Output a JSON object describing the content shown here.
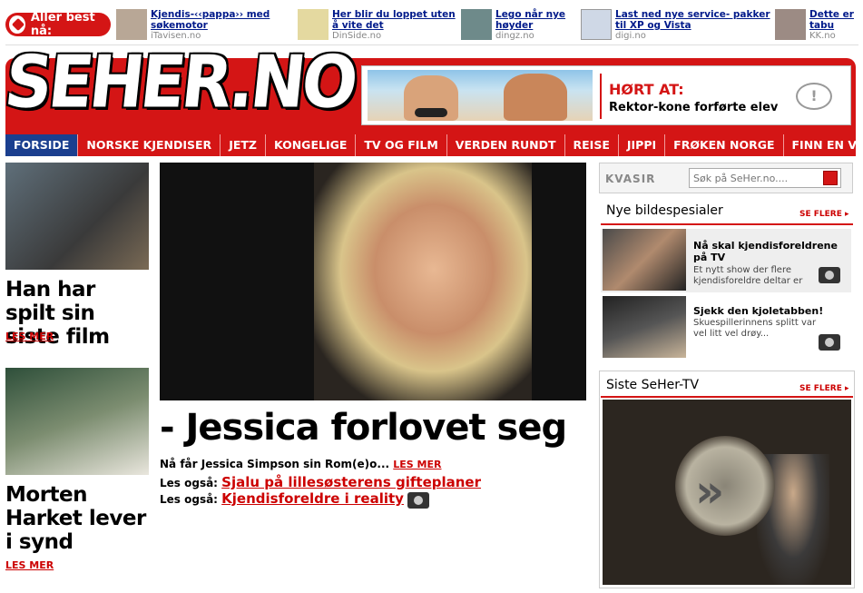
{
  "topbar": {
    "badge": "Aller best nå:",
    "promos": [
      {
        "title": "Kjendis-‹‹pappa›› med søkemotor",
        "source": "iTavisen.no"
      },
      {
        "title": "Her blir du loppet uten å vite det",
        "source": "DinSide.no"
      },
      {
        "title": "Lego når nye høyder",
        "source": "dingz.no"
      },
      {
        "title": "Last ned nye service- pakker til XP og Vista",
        "source": "digi.no"
      },
      {
        "title": "Dette er tabu",
        "source": "KK.no"
      }
    ]
  },
  "header": {
    "logo": "SEHER.NO",
    "banner_head": "HØRT AT:",
    "banner_sub": "Rektor-kone forførte elev"
  },
  "nav": [
    "FORSIDE",
    "NORSKE KJENDISER",
    "JETZ",
    "KONGELIGE",
    "TV OG FILM",
    "VERDEN RUNDT",
    "REISE",
    "JIPPI",
    "FRØKEN NORGE",
    "FINN EN VENN"
  ],
  "left": [
    {
      "headline": "Han har spilt sin siste film",
      "more": "LES MER"
    },
    {
      "headline": "Morten Harket lever i synd",
      "more": "LES MER"
    }
  ],
  "main": {
    "headline": "- Jessica forlovet seg",
    "lead": "Nå får Jessica Simpson sin Rom(e)o...",
    "lead_more": "LES MER",
    "also_label": "Les også:",
    "also1": "Sjalu på lillesøsterens gifteplaner",
    "also2": "Kjendisforeldre i reality"
  },
  "right": {
    "kvasir": "KVASIR",
    "search_placeholder": "Søk på SeHer.no....",
    "section1": "Nye bildespesialer",
    "section1_more": "SE FLERE",
    "items": [
      {
        "title": "Nå skal kjendisforeldrene på TV",
        "text": "Et nytt show der flere kjendisforeldre deltar er under utvikling."
      },
      {
        "title": "Sjekk den kjoletabben!",
        "text": "Skuespillerinnens splitt var vel litt vel drøy..."
      }
    ],
    "section2": "Siste SeHer-TV",
    "section2_more": "SE FLERE"
  }
}
